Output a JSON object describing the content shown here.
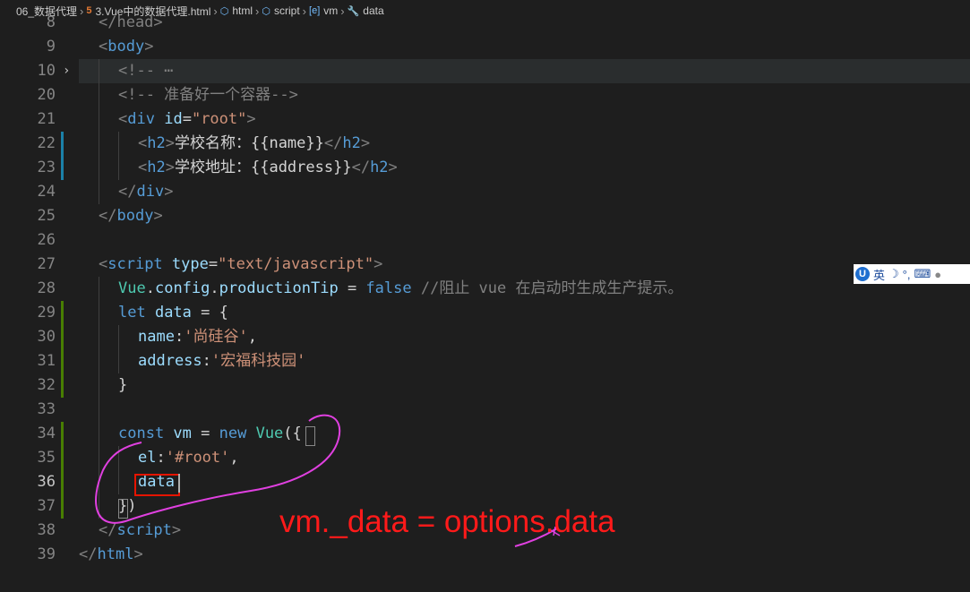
{
  "breadcrumb": {
    "items": [
      {
        "label": "06_数据代理"
      },
      {
        "label": "3.Vue中的数据代理.html",
        "icon": "html5-icon"
      },
      {
        "label": "html",
        "icon": "cube-icon"
      },
      {
        "label": "script",
        "icon": "cube-icon"
      },
      {
        "label": "vm",
        "icon": "brackets-icon"
      },
      {
        "label": "data",
        "icon": "wrench-icon"
      }
    ]
  },
  "editor": {
    "active_line": "36",
    "lines": [
      {
        "num": "8"
      },
      {
        "num": "9"
      },
      {
        "num": "10"
      },
      {
        "num": "20"
      },
      {
        "num": "21"
      },
      {
        "num": "22"
      },
      {
        "num": "23"
      },
      {
        "num": "24"
      },
      {
        "num": "25"
      },
      {
        "num": "26"
      },
      {
        "num": "27"
      },
      {
        "num": "28"
      },
      {
        "num": "29"
      },
      {
        "num": "30"
      },
      {
        "num": "31"
      },
      {
        "num": "32"
      },
      {
        "num": "33"
      },
      {
        "num": "34"
      },
      {
        "num": "35"
      },
      {
        "num": "36"
      },
      {
        "num": "37"
      },
      {
        "num": "38"
      },
      {
        "num": "39"
      }
    ],
    "code": {
      "l8": "</head>",
      "l9_tag": "body",
      "l10_comment": "<!-- ",
      "l10_ellipsis": "⋯",
      "l20_comment": "<!-- 准备好一个容器-->",
      "l21_tag": "div",
      "l21_attr": "id",
      "l21_val": "\"root\"",
      "l22_tag": "h2",
      "l22_text": "学校名称：{{name}}",
      "l23_tag": "h2",
      "l23_text": "学校地址：{{address}}",
      "l24_tag": "div",
      "l25_tag": "body",
      "l27_tag": "script",
      "l27_attr": "type",
      "l27_val": "\"text/javascript\"",
      "l28_cls": "Vue",
      "l28_prop1": "config",
      "l28_prop2": "productionTip",
      "l28_op": " = ",
      "l28_kw": "false",
      "l28_comment": " //阻止 vue 在启动时生成生产提示。",
      "l29_kw": "let",
      "l29_var": " data",
      "l29_rest": " = {",
      "l30_key": "name",
      "l30_val": "'尚硅谷'",
      "l31_key": "address",
      "l31_val": "'宏福科技园'",
      "l32": "}",
      "l34_kw": "const",
      "l34_var": " vm",
      "l34_op": " = ",
      "l34_new": "new",
      "l34_cls": " Vue",
      "l34_paren": "({",
      "l35_key": "el",
      "l35_val": "'#root'",
      "l35_comma": ",",
      "l36_var": "data",
      "l37": "})",
      "l38_tag": "script",
      "l39_tag": "html"
    }
  },
  "annotation": {
    "text": "vm._data = options.data",
    "color": "#ff1a1a"
  },
  "ime_toolbar": {
    "logo": "U",
    "lang": "英",
    "moon": "☽",
    "punct": "°,",
    "keyboard": "⌨",
    "user": "👤"
  }
}
